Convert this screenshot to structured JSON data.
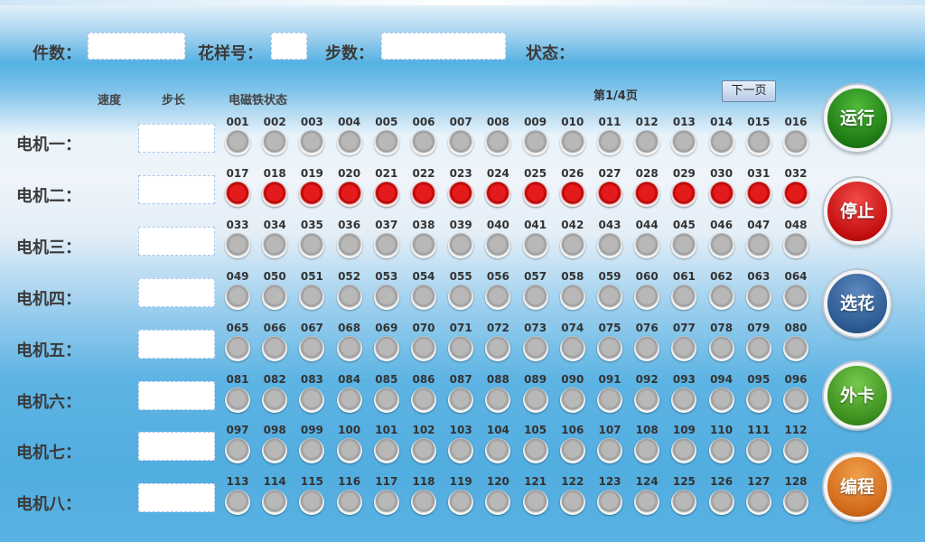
{
  "header": {
    "count_label": "件数：",
    "pattern_label": "花样号：",
    "steps_label": "步数：",
    "status_label": "状态："
  },
  "columns": {
    "speed": "速度",
    "step": "步长",
    "magnet_status": "电磁铁状态"
  },
  "pagination": {
    "page": "第1/4页",
    "next_label": "下一页"
  },
  "motors": [
    {
      "label": "电机一：",
      "cells": [
        "001",
        "002",
        "003",
        "004",
        "005",
        "006",
        "007",
        "008",
        "009",
        "010",
        "011",
        "012",
        "013",
        "014",
        "015",
        "016"
      ],
      "state": "off"
    },
    {
      "label": "电机二：",
      "cells": [
        "017",
        "018",
        "019",
        "020",
        "021",
        "022",
        "023",
        "024",
        "025",
        "026",
        "027",
        "028",
        "029",
        "030",
        "031",
        "032"
      ],
      "state": "on"
    },
    {
      "label": "电机三：",
      "cells": [
        "033",
        "034",
        "035",
        "036",
        "037",
        "038",
        "039",
        "040",
        "041",
        "042",
        "043",
        "044",
        "045",
        "046",
        "047",
        "048"
      ],
      "state": "off"
    },
    {
      "label": "电机四：",
      "cells": [
        "049",
        "050",
        "051",
        "052",
        "053",
        "054",
        "055",
        "056",
        "057",
        "058",
        "059",
        "060",
        "061",
        "062",
        "063",
        "064"
      ],
      "state": "off"
    },
    {
      "label": "电机五：",
      "cells": [
        "065",
        "066",
        "067",
        "068",
        "069",
        "070",
        "071",
        "072",
        "073",
        "074",
        "075",
        "076",
        "077",
        "078",
        "079",
        "080"
      ],
      "state": "off"
    },
    {
      "label": "电机六：",
      "cells": [
        "081",
        "082",
        "083",
        "084",
        "085",
        "086",
        "087",
        "088",
        "089",
        "090",
        "091",
        "092",
        "093",
        "094",
        "095",
        "096"
      ],
      "state": "off"
    },
    {
      "label": "电机七：",
      "cells": [
        "097",
        "098",
        "099",
        "100",
        "101",
        "102",
        "103",
        "104",
        "105",
        "106",
        "107",
        "108",
        "109",
        "110",
        "111",
        "112"
      ],
      "state": "off"
    },
    {
      "label": "电机八：",
      "cells": [
        "113",
        "114",
        "115",
        "116",
        "117",
        "118",
        "119",
        "120",
        "121",
        "122",
        "123",
        "124",
        "125",
        "126",
        "127",
        "128"
      ],
      "state": "off"
    }
  ],
  "buttons": {
    "run": "运行",
    "stop": "停止",
    "select": "选花",
    "external": "外卡",
    "program": "编程"
  },
  "colors": {
    "lamp_on": "#d01010",
    "lamp_off": "#a8a8a8",
    "run": "#2a8a1c",
    "stop": "#c81414",
    "select": "#3a6aa6",
    "external": "#4aa02a",
    "program": "#d87020"
  }
}
